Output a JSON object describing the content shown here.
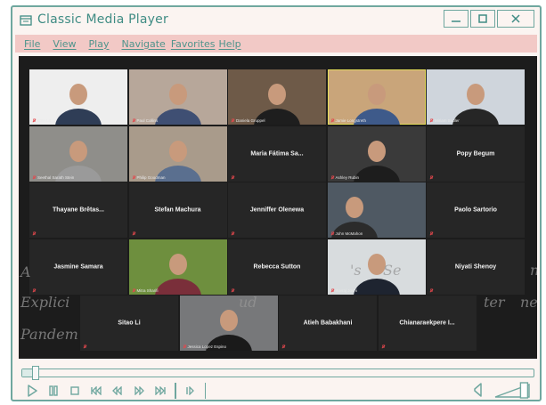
{
  "window": {
    "title": "Classic Media Player",
    "app_icon": "media-folder-icon",
    "buttons": [
      "minimize-icon",
      "maximize-icon",
      "close-icon"
    ]
  },
  "menu": {
    "items": [
      "File",
      "View",
      "Play",
      "Navigate",
      "Favorites",
      "Help"
    ]
  },
  "video": {
    "overlay_lines": [
      "A",
      "'s",
      "Se",
      "n",
      "Explici",
      "ud",
      "ter",
      "ne",
      "Pandem"
    ],
    "tiles": [
      {
        "kind": "video",
        "label": "ESA Lit",
        "bg": "#eeeeee"
      },
      {
        "kind": "video",
        "label": "Paul Collins",
        "bg": "#b7a79a"
      },
      {
        "kind": "video",
        "label": "Daniela Gruppel",
        "bg": "#6e5a48"
      },
      {
        "kind": "video",
        "label": "Jamie Longstreth",
        "bg": "#c9a57a"
      },
      {
        "kind": "video",
        "label": "Miriam Sudler",
        "bg": "#cfd5dc"
      },
      {
        "kind": "video",
        "label": "Seethal Sarath Stein",
        "bg": "#8f8e8a"
      },
      {
        "kind": "video",
        "label": "Philip Goodman",
        "bg": "#a99b8b"
      },
      {
        "kind": "name",
        "name": "Maria Fátima Sa...",
        "label": ""
      },
      {
        "kind": "video",
        "label": "Ashley Rubin",
        "bg": "#3a3a3a"
      },
      {
        "kind": "name",
        "name": "Popy Begum",
        "label": ""
      },
      {
        "kind": "name",
        "name": "Thayane Brêtas...",
        "label": ""
      },
      {
        "kind": "name",
        "name": "Stefan Machura",
        "label": ""
      },
      {
        "kind": "name",
        "name": "Jenniffer Olenewa",
        "label": ""
      },
      {
        "kind": "video",
        "label": "John McMahon",
        "bg": "#4f5963"
      },
      {
        "kind": "name",
        "name": "Paolo Sartorio",
        "label": ""
      },
      {
        "kind": "name",
        "name": "Jasmine Samara",
        "label": ""
      },
      {
        "kind": "video",
        "label": "Mitra Sharifi",
        "bg": "#6e8f3e"
      },
      {
        "kind": "name",
        "name": "Rebecca Sutton",
        "label": ""
      },
      {
        "kind": "video",
        "label": "Yuvraj Joshi",
        "bg": "#d8dcde"
      },
      {
        "kind": "name",
        "name": "Niyati Shenoy",
        "label": ""
      },
      {
        "kind": "name",
        "name": "Sitao Li",
        "label": ""
      },
      {
        "kind": "video",
        "label": "Jessica Lopez Espino",
        "bg": "#77787a"
      },
      {
        "kind": "name",
        "name": "Atieh Babakhani",
        "label": ""
      },
      {
        "kind": "name",
        "name": "Chianaraekpere I...",
        "label": ""
      }
    ]
  },
  "playback": {
    "progress": 0.02,
    "volume_level": 0.8,
    "controls": [
      "play-icon",
      "pause-icon",
      "stop-icon",
      "skip-to-start-icon",
      "rewind-icon",
      "fast-forward-icon",
      "skip-to-end-icon",
      "frame-step-icon"
    ],
    "accent": "#6fa79f"
  }
}
